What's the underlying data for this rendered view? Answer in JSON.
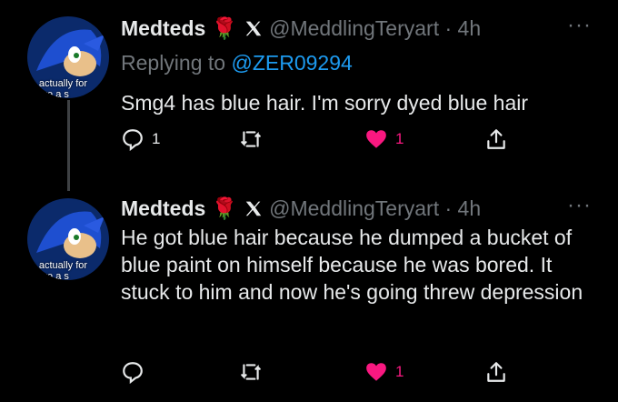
{
  "tweets": [
    {
      "display_name": "Medteds",
      "name_emoji": "🌹",
      "handle": "@MeddlingTeryart",
      "separator": "·",
      "time": "4h",
      "replying_prefix": "Replying to",
      "replying_to": "@ZER09294",
      "text": "Smg4 has blue hair. I'm sorry dyed blue hair",
      "avatar_caption_1": "ro actually for",
      "avatar_caption_2": "give a s",
      "reply_count": "1",
      "retweet_count": "",
      "like_count": "1",
      "liked": true
    },
    {
      "display_name": "Medteds",
      "name_emoji": "🌹",
      "handle": "@MeddlingTeryart",
      "separator": "·",
      "time": "4h",
      "text": "He got blue hair because he dumped a bucket of blue paint on himself because he was bored. It stuck to him and now he's going threw depression",
      "avatar_caption_1": "ro actually for",
      "avatar_caption_2": "give a s",
      "reply_count": "",
      "retweet_count": "",
      "like_count": "1",
      "liked": true
    }
  ],
  "colors": {
    "background": "#000000",
    "text": "#e7e9ea",
    "muted": "#71767b",
    "link": "#1d9bf0",
    "like": "#f91880"
  },
  "icons": [
    "more-icon",
    "verified-icon",
    "reply-icon",
    "retweet-icon",
    "heart-icon",
    "share-icon"
  ]
}
